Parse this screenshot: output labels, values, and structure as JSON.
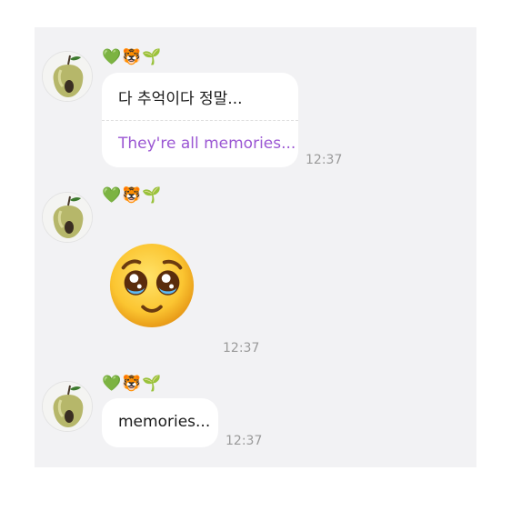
{
  "messages": [
    {
      "sender_emoji": "💚🐯🌱",
      "text": "다 추억이다 정말...",
      "translation": "They're all memories...",
      "time": "12:37"
    },
    {
      "sender_emoji": "💚🐯🌱",
      "sticker": "pleading-face-emoji",
      "time": "12:37"
    },
    {
      "sender_emoji": "💚🐯🌱",
      "text": "memories...",
      "time": "12:37"
    }
  ],
  "colors": {
    "background": "#f2f2f4",
    "bubble": "#ffffff",
    "translation_text": "#9b57d3",
    "timestamp": "#9a9a9a"
  }
}
